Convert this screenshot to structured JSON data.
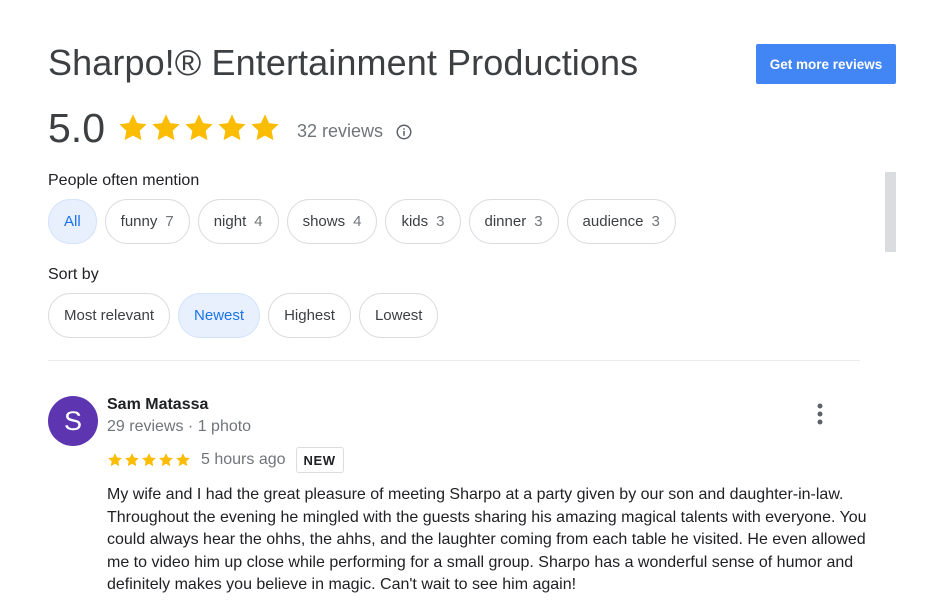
{
  "header": {
    "title": "Sharpo!® Entertainment Productions",
    "get_more_reviews_label": "Get more reviews"
  },
  "summary": {
    "rating": "5.0",
    "stars": 5,
    "reviews_text": "32 reviews"
  },
  "mentions": {
    "label": "People often mention",
    "chips": [
      {
        "label": "All",
        "count": "",
        "selected": true
      },
      {
        "label": "funny",
        "count": "7",
        "selected": false
      },
      {
        "label": "night",
        "count": "4",
        "selected": false
      },
      {
        "label": "shows",
        "count": "4",
        "selected": false
      },
      {
        "label": "kids",
        "count": "3",
        "selected": false
      },
      {
        "label": "dinner",
        "count": "3",
        "selected": false
      },
      {
        "label": "audience",
        "count": "3",
        "selected": false
      }
    ]
  },
  "sort": {
    "label": "Sort by",
    "options": [
      {
        "label": "Most relevant",
        "selected": false
      },
      {
        "label": "Newest",
        "selected": true
      },
      {
        "label": "Highest",
        "selected": false
      },
      {
        "label": "Lowest",
        "selected": false
      }
    ]
  },
  "review": {
    "avatar_letter": "S",
    "avatar_color": "#5e35b1",
    "name": "Sam Matassa",
    "meta": "29 reviews · 1 photo",
    "stars": 5,
    "time_ago": "5 hours ago",
    "badge": "NEW",
    "text": "My wife and I had the great pleasure of meeting Sharpo at a party given by our son and daughter-in-law. Throughout the evening he mingled with the guests sharing his amazing magical talents with everyone. You could always hear the ohhs, the ahhs, and the laughter coming from each table he visited. He even allowed me to video him up close while performing for a small group. Sharpo has a wonderful sense of humor and definitely makes you believe in magic. Can't wait to see him again!"
  },
  "icons": {
    "star": "star-icon",
    "info": "info-icon",
    "more": "more-vert-icon"
  },
  "colors": {
    "star": "#fbbc04",
    "accent": "#1a73e8",
    "button": "#4285f4"
  }
}
